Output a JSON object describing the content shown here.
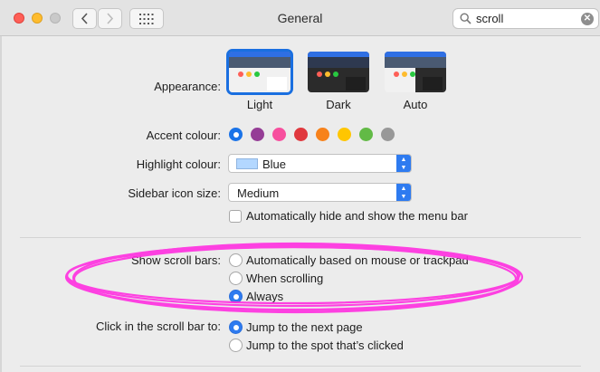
{
  "window": {
    "title": "General"
  },
  "search": {
    "value": "scroll",
    "icon": "search-icon",
    "clear_icon": "clear-icon"
  },
  "appearance": {
    "label": "Appearance:",
    "options": [
      {
        "label": "Light",
        "selected": true
      },
      {
        "label": "Dark",
        "selected": false
      },
      {
        "label": "Auto",
        "selected": false
      }
    ]
  },
  "accent": {
    "label": "Accent colour:",
    "colors": [
      "#1a73e8",
      "#953d96",
      "#f74f9e",
      "#e0383e",
      "#f7821b",
      "#ffc600",
      "#62ba46",
      "#989898"
    ],
    "selected_index": 0
  },
  "highlight": {
    "label": "Highlight colour:",
    "value": "Blue",
    "swatch": "#b3d7ff"
  },
  "sidebar_icon": {
    "label": "Sidebar icon size:",
    "value": "Medium"
  },
  "menubar": {
    "label": "Automatically hide and show the menu bar",
    "checked": false
  },
  "scrollbars": {
    "label": "Show scroll bars:",
    "options": [
      {
        "label": "Automatically based on mouse or trackpad",
        "selected": false
      },
      {
        "label": "When scrolling",
        "selected": false
      },
      {
        "label": "Always",
        "selected": true
      }
    ]
  },
  "click_scroll": {
    "label": "Click in the scroll bar to:",
    "options": [
      {
        "label": "Jump to the next page",
        "selected": true
      },
      {
        "label": "Jump to the spot that’s clicked",
        "selected": false
      }
    ]
  },
  "annotation": {
    "color": "#ff2fe0"
  }
}
